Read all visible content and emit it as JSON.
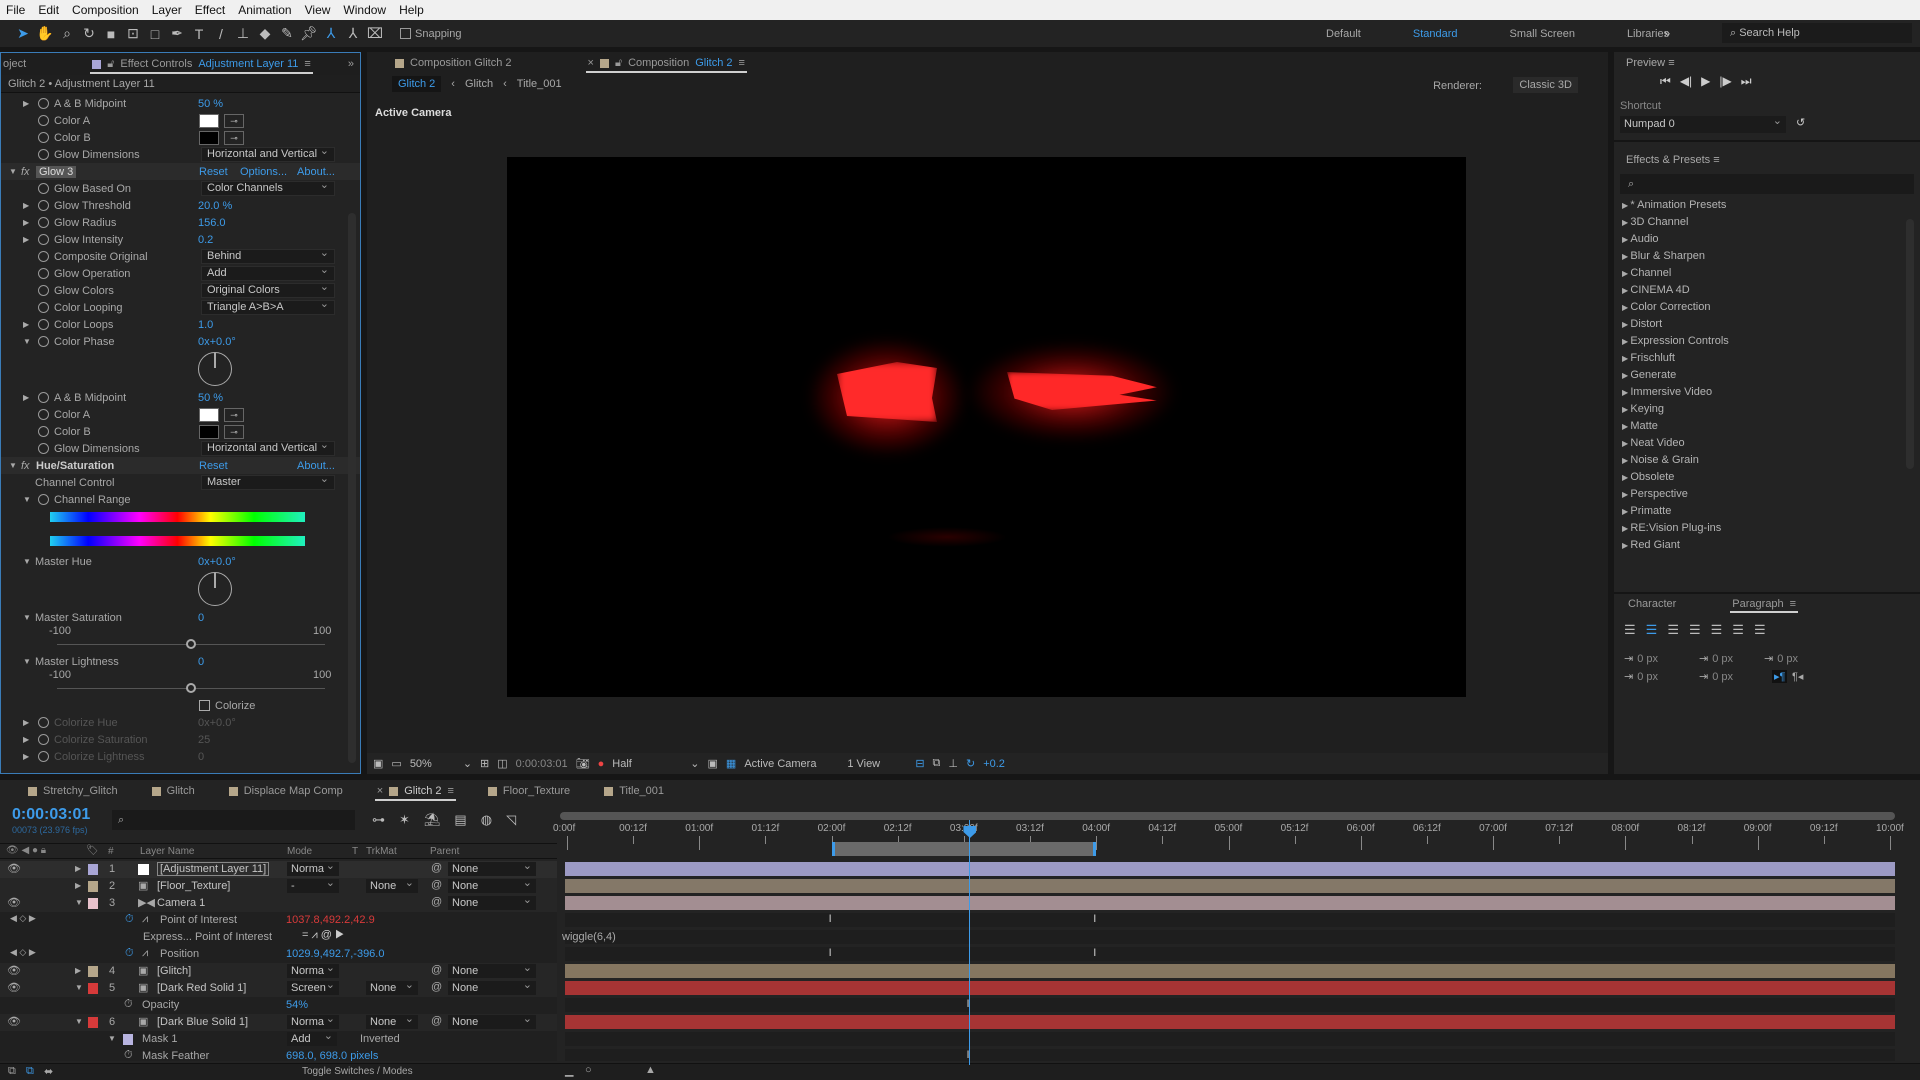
{
  "menu": [
    "File",
    "Edit",
    "Composition",
    "Layer",
    "Effect",
    "Animation",
    "View",
    "Window",
    "Help"
  ],
  "toolbar": {
    "snapping": "Snapping",
    "workspaces": [
      "Default",
      "Standard",
      "Small Screen",
      "Libraries"
    ],
    "active_workspace": "Standard",
    "search_placeholder": "Search Help"
  },
  "left_panel": {
    "tab_project": "oject",
    "tab_effect_controls": "Effect Controls",
    "tab_layer": "Adjustment Layer 11",
    "breadcrumb": "Glitch 2 • Adjustment Layer 11",
    "rows": [
      {
        "t": "prop",
        "tri": "▶",
        "label": "A & B Midpoint",
        "value": "50 %"
      },
      {
        "t": "color",
        "label": "Color A",
        "color": "#ffffff"
      },
      {
        "t": "color",
        "label": "Color B",
        "color": "#000000"
      },
      {
        "t": "dd",
        "label": "Glow Dimensions",
        "value": "Horizontal and Vertical"
      },
      {
        "t": "fx",
        "label": "Glow 3",
        "reset": "Reset",
        "options": "Options...",
        "about": "About..."
      },
      {
        "t": "dd",
        "label": "Glow Based On",
        "value": "Color Channels"
      },
      {
        "t": "prop",
        "tri": "▶",
        "label": "Glow Threshold",
        "value": "20.0 %"
      },
      {
        "t": "prop",
        "tri": "▶",
        "label": "Glow Radius",
        "value": "156.0"
      },
      {
        "t": "prop",
        "tri": "▶",
        "label": "Glow Intensity",
        "value": "0.2"
      },
      {
        "t": "dd",
        "label": "Composite Original",
        "value": "Behind"
      },
      {
        "t": "dd",
        "label": "Glow Operation",
        "value": "Add"
      },
      {
        "t": "dd",
        "label": "Glow Colors",
        "value": "Original Colors"
      },
      {
        "t": "dd",
        "label": "Color Looping",
        "value": "Triangle A>B>A"
      },
      {
        "t": "prop",
        "tri": "▶",
        "label": "Color Loops",
        "value": "1.0"
      },
      {
        "t": "prop",
        "tri": "▼",
        "label": "Color Phase",
        "value": "0x+0.0°"
      },
      {
        "t": "dial"
      },
      {
        "t": "prop",
        "tri": "▶",
        "label": "A & B Midpoint",
        "value": "50 %"
      },
      {
        "t": "color",
        "label": "Color A",
        "color": "#ffffff"
      },
      {
        "t": "color",
        "label": "Color B",
        "color": "#000000"
      },
      {
        "t": "dd",
        "label": "Glow Dimensions",
        "value": "Horizontal and Vertical"
      },
      {
        "t": "fx",
        "label": "Hue/Saturation",
        "reset": "Reset",
        "about": "About..."
      },
      {
        "t": "dd",
        "label": "Channel Control",
        "value": "Master",
        "nosw": true
      },
      {
        "t": "prop",
        "tri": "▼",
        "label": "Channel Range",
        "value": ""
      },
      {
        "t": "range"
      },
      {
        "t": "prop",
        "tri": "▼",
        "label": "Master Hue",
        "value": "0x+0.0°",
        "nosw": true
      },
      {
        "t": "dial"
      },
      {
        "t": "prop",
        "tri": "▼",
        "label": "Master Saturation",
        "value": "0",
        "nosw": true
      },
      {
        "t": "slider",
        "min": "-100",
        "max": "100",
        "level": 0.5
      },
      {
        "t": "prop",
        "tri": "▼",
        "label": "Master Lightness",
        "value": "0",
        "nosw": true
      },
      {
        "t": "slider",
        "min": "-100",
        "max": "100",
        "level": 0.5
      },
      {
        "t": "check",
        "label": "Colorize"
      },
      {
        "t": "prop",
        "tri": "▶",
        "label": "Colorize Hue",
        "value": "0x+0.0°",
        "dim": true
      },
      {
        "t": "prop",
        "tri": "▶",
        "label": "Colorize Saturation",
        "value": "25",
        "dim": true
      },
      {
        "t": "prop",
        "tri": "▶",
        "label": "Colorize Lightness",
        "value": "0",
        "dim": true
      }
    ]
  },
  "viewer": {
    "tab1": "Composition Glitch 2",
    "tab2_prefix": "Composition",
    "tab2_name": "Glitch 2",
    "breadcrumbs": [
      "Glitch 2",
      "Glitch",
      "Title_001"
    ],
    "renderer_label": "Renderer:",
    "renderer": "Classic 3D",
    "camera_label": "Active Camera",
    "bottom": {
      "zoom": "50%",
      "time": "0:00:03:01",
      "resolution": "Half",
      "view": "Active Camera",
      "layout": "1 View",
      "exposure": "+0.2"
    }
  },
  "right_panel": {
    "preview_title": "Preview",
    "shortcut_label": "Shortcut",
    "shortcut_value": "Numpad 0",
    "effects_title": "Effects & Presets",
    "effects": [
      "* Animation Presets",
      "3D Channel",
      "Audio",
      "Blur & Sharpen",
      "Channel",
      "CINEMA 4D",
      "Color Correction",
      "Distort",
      "Expression Controls",
      "Frischluft",
      "Generate",
      "Immersive Video",
      "Keying",
      "Matte",
      "Neat Video",
      "Noise & Grain",
      "Obsolete",
      "Perspective",
      "Primatte",
      "RE:Vision Plug-ins",
      "Red Giant"
    ],
    "character_tab": "Character",
    "paragraph_tab": "Paragraph",
    "indent_values": [
      "0 px",
      "0 px",
      "0 px",
      "0 px",
      "0 px"
    ]
  },
  "timeline": {
    "tabs": [
      {
        "name": "Stretchy_Glitch",
        "color": "#b5a68a"
      },
      {
        "name": "Glitch",
        "color": "#b5a68a"
      },
      {
        "name": "Displace Map Comp",
        "color": "#b5a68a"
      },
      {
        "name": "Glitch 2",
        "color": "#b5a68a",
        "active": true
      },
      {
        "name": "Floor_Texture",
        "color": "#b5a68a"
      },
      {
        "name": "Title_001",
        "color": "#b5a68a"
      }
    ],
    "timecode": "0:00:03:01",
    "frame_info": "00073 (23.976 fps)",
    "columns": {
      "num": "#",
      "name": "Layer Name",
      "mode": "Mode",
      "t": "T",
      "trkmat": "TrkMat",
      "parent": "Parent"
    },
    "ruler": [
      "0:00f",
      "00:12f",
      "01:00f",
      "01:12f",
      "02:00f",
      "02:12f",
      "03:00f",
      "03:12f",
      "04:00f",
      "04:12f",
      "05:00f",
      "05:12f",
      "06:00f",
      "06:12f",
      "07:00f",
      "07:12f",
      "08:00f",
      "08:12f",
      "09:00f",
      "09:12f",
      "10:00f"
    ],
    "duration_seconds": 10,
    "current_time_seconds": 3.042,
    "work_area": [
      2,
      4
    ],
    "rows": [
      {
        "t": "layer",
        "eye": true,
        "num": "1",
        "name": "[Adjustment Layer 11]",
        "label": "#a9a6d6",
        "mode": "Norma",
        "parent": "None",
        "bar": "#9c9ac4",
        "selected": true
      },
      {
        "t": "layer",
        "eye": false,
        "num": "2",
        "name": "[Floor_Texture]",
        "label": "#b5a68a",
        "mode": "-",
        "trkmat": "None",
        "parent": "None",
        "bar": "#847868"
      },
      {
        "t": "layer",
        "eye": true,
        "num": "3",
        "name": "Camera 1",
        "label": "#e8c2cc",
        "expanded": true,
        "parent": "None",
        "bar": "#a38e92"
      },
      {
        "t": "prop",
        "name": "Point of Interest",
        "value": "1037.8,492.2,42.9",
        "red": true,
        "nav": true,
        "keys": [
          2,
          4
        ]
      },
      {
        "t": "expr",
        "name": "Express... Point of Interest",
        "expr": "wiggle(6,4)"
      },
      {
        "t": "prop",
        "name": "Position",
        "value": "1029.9,492.7,-396.0",
        "nav": true,
        "keys": [
          2,
          4
        ]
      },
      {
        "t": "layer",
        "eye": true,
        "num": "4",
        "name": "[Glitch]",
        "label": "#b5a68a",
        "mode": "Norma",
        "parent": "None",
        "bar": "#857660"
      },
      {
        "t": "layer",
        "eye": true,
        "num": "5",
        "name": "[Dark Red Solid 1]",
        "label": "#d63a3a",
        "expanded": true,
        "mode": "Screen",
        "trkmat": "None",
        "parent": "None",
        "bar": "#a63434"
      },
      {
        "t": "prop",
        "name": "Opacity",
        "value": "54%",
        "keys": [
          3.042
        ],
        "indent": true
      },
      {
        "t": "layer",
        "eye": true,
        "num": "6",
        "name": "[Dark Blue Solid 1]",
        "label": "#d63a3a",
        "expanded": true,
        "mode": "Norma",
        "trkmat": "None",
        "parent": "None",
        "bar": "#a63434"
      },
      {
        "t": "mask",
        "name": "Mask 1",
        "mode": "Add",
        "inverted": "Inverted"
      },
      {
        "t": "prop",
        "name": "Mask Feather",
        "value": "698.0, 698.0 pixels",
        "keys": [
          3.042
        ],
        "indent": true
      }
    ],
    "toggle_label": "Toggle Switches / Modes"
  },
  "colors": {
    "accent": "#3d9be9",
    "panel": "#232323",
    "glow": "#ff1a1a"
  }
}
